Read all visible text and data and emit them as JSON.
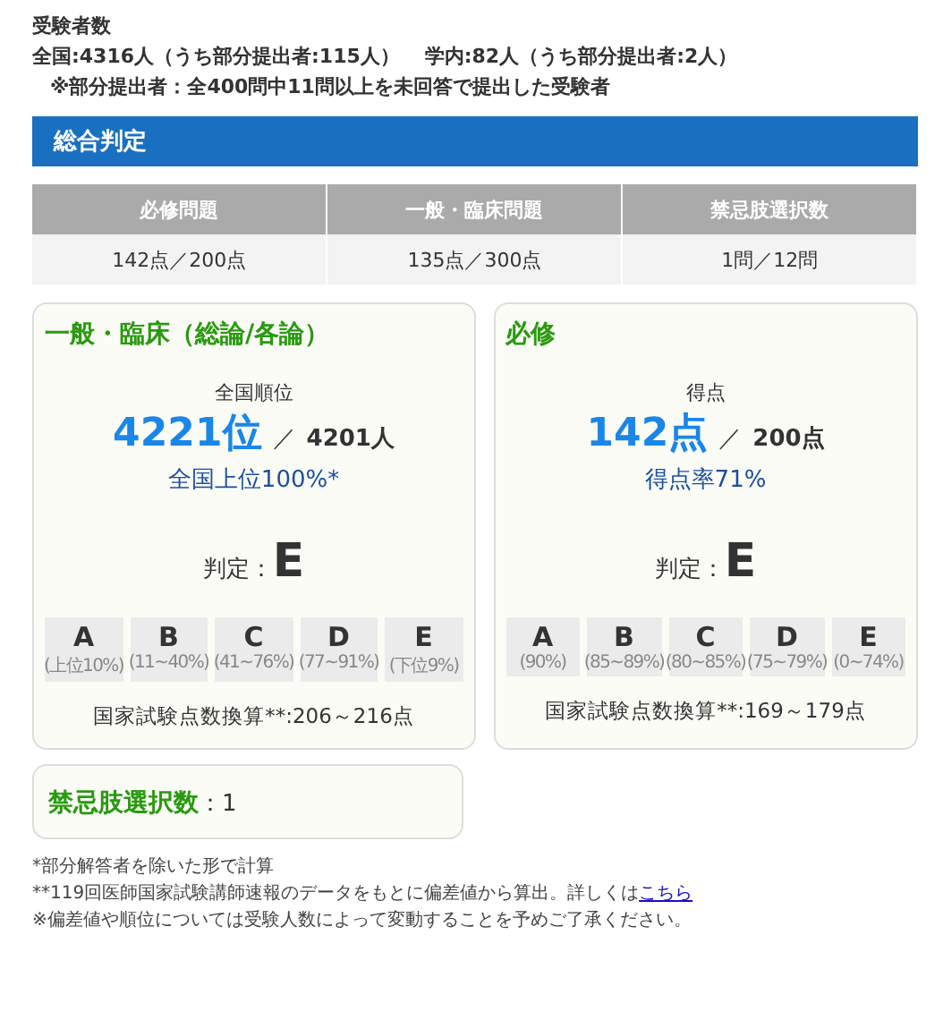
{
  "examinees": {
    "title": "受験者数",
    "counts": [
      "全国:4316人（うち部分提出者:115人）",
      "学内:82人（うち部分提出者:2人）"
    ],
    "note": "※部分提出者：全400問中11問以上を未回答で提出した受験者"
  },
  "summary": {
    "title": "総合判定",
    "columns": [
      "必修問題",
      "一般・臨床問題",
      "禁忌肢選択数"
    ],
    "values": [
      "142点／200点",
      "135点／300点",
      "1問／12問"
    ]
  },
  "cards": [
    {
      "title": "一般・臨床（総論/各論）",
      "label": "全国順位",
      "main": "4221位",
      "sep": "／",
      "total": "4201人",
      "sub": "全国上位100%*",
      "judgement_label": "判定：",
      "judgement": "E",
      "grades": [
        {
          "letter": "A",
          "range": "(上位10%)"
        },
        {
          "letter": "B",
          "range": "(11~40%)"
        },
        {
          "letter": "C",
          "range": "(41~76%)"
        },
        {
          "letter": "D",
          "range": "(77~91%)"
        },
        {
          "letter": "E",
          "range": "(下位9%)"
        }
      ],
      "conversion": "国家試験点数換算**:206～216点"
    },
    {
      "title": "必修",
      "label": "得点",
      "main": "142点",
      "sep": "／",
      "total": "200点",
      "sub": "得点率71%",
      "judgement_label": "判定：",
      "judgement": "E",
      "grades": [
        {
          "letter": "A",
          "range": "(90%)"
        },
        {
          "letter": "B",
          "range": "(85~89%)"
        },
        {
          "letter": "C",
          "range": "(80~85%)"
        },
        {
          "letter": "D",
          "range": "(75~79%)"
        },
        {
          "letter": "E",
          "range": "(0~74%)"
        }
      ],
      "conversion": "国家試験点数換算**:169～179点"
    }
  ],
  "kinki": {
    "label": "禁忌肢選択数",
    "value": "：1"
  },
  "footnotes": [
    {
      "text": "*部分解答者を除いた形で計算"
    },
    {
      "text": "**119回医師国家試験講師速報のデータをもとに偏差値から算出。詳しくは",
      "link": "こちら"
    },
    {
      "text": "※偏差値や順位については受験人数によって変動することを予めご了承ください。"
    }
  ]
}
